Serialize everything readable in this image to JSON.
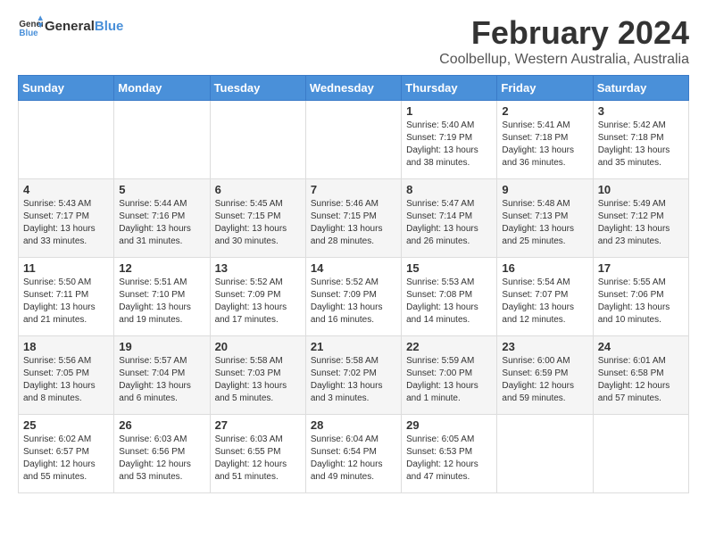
{
  "logo": {
    "text_general": "General",
    "text_blue": "Blue"
  },
  "title": "February 2024",
  "subtitle": "Coolbellup, Western Australia, Australia",
  "days_of_week": [
    "Sunday",
    "Monday",
    "Tuesday",
    "Wednesday",
    "Thursday",
    "Friday",
    "Saturday"
  ],
  "weeks": [
    [
      {
        "day": "",
        "info": ""
      },
      {
        "day": "",
        "info": ""
      },
      {
        "day": "",
        "info": ""
      },
      {
        "day": "",
        "info": ""
      },
      {
        "day": "1",
        "info": "Sunrise: 5:40 AM\nSunset: 7:19 PM\nDaylight: 13 hours\nand 38 minutes."
      },
      {
        "day": "2",
        "info": "Sunrise: 5:41 AM\nSunset: 7:18 PM\nDaylight: 13 hours\nand 36 minutes."
      },
      {
        "day": "3",
        "info": "Sunrise: 5:42 AM\nSunset: 7:18 PM\nDaylight: 13 hours\nand 35 minutes."
      }
    ],
    [
      {
        "day": "4",
        "info": "Sunrise: 5:43 AM\nSunset: 7:17 PM\nDaylight: 13 hours\nand 33 minutes."
      },
      {
        "day": "5",
        "info": "Sunrise: 5:44 AM\nSunset: 7:16 PM\nDaylight: 13 hours\nand 31 minutes."
      },
      {
        "day": "6",
        "info": "Sunrise: 5:45 AM\nSunset: 7:15 PM\nDaylight: 13 hours\nand 30 minutes."
      },
      {
        "day": "7",
        "info": "Sunrise: 5:46 AM\nSunset: 7:15 PM\nDaylight: 13 hours\nand 28 minutes."
      },
      {
        "day": "8",
        "info": "Sunrise: 5:47 AM\nSunset: 7:14 PM\nDaylight: 13 hours\nand 26 minutes."
      },
      {
        "day": "9",
        "info": "Sunrise: 5:48 AM\nSunset: 7:13 PM\nDaylight: 13 hours\nand 25 minutes."
      },
      {
        "day": "10",
        "info": "Sunrise: 5:49 AM\nSunset: 7:12 PM\nDaylight: 13 hours\nand 23 minutes."
      }
    ],
    [
      {
        "day": "11",
        "info": "Sunrise: 5:50 AM\nSunset: 7:11 PM\nDaylight: 13 hours\nand 21 minutes."
      },
      {
        "day": "12",
        "info": "Sunrise: 5:51 AM\nSunset: 7:10 PM\nDaylight: 13 hours\nand 19 minutes."
      },
      {
        "day": "13",
        "info": "Sunrise: 5:52 AM\nSunset: 7:09 PM\nDaylight: 13 hours\nand 17 minutes."
      },
      {
        "day": "14",
        "info": "Sunrise: 5:52 AM\nSunset: 7:09 PM\nDaylight: 13 hours\nand 16 minutes."
      },
      {
        "day": "15",
        "info": "Sunrise: 5:53 AM\nSunset: 7:08 PM\nDaylight: 13 hours\nand 14 minutes."
      },
      {
        "day": "16",
        "info": "Sunrise: 5:54 AM\nSunset: 7:07 PM\nDaylight: 13 hours\nand 12 minutes."
      },
      {
        "day": "17",
        "info": "Sunrise: 5:55 AM\nSunset: 7:06 PM\nDaylight: 13 hours\nand 10 minutes."
      }
    ],
    [
      {
        "day": "18",
        "info": "Sunrise: 5:56 AM\nSunset: 7:05 PM\nDaylight: 13 hours\nand 8 minutes."
      },
      {
        "day": "19",
        "info": "Sunrise: 5:57 AM\nSunset: 7:04 PM\nDaylight: 13 hours\nand 6 minutes."
      },
      {
        "day": "20",
        "info": "Sunrise: 5:58 AM\nSunset: 7:03 PM\nDaylight: 13 hours\nand 5 minutes."
      },
      {
        "day": "21",
        "info": "Sunrise: 5:58 AM\nSunset: 7:02 PM\nDaylight: 13 hours\nand 3 minutes."
      },
      {
        "day": "22",
        "info": "Sunrise: 5:59 AM\nSunset: 7:00 PM\nDaylight: 13 hours\nand 1 minute."
      },
      {
        "day": "23",
        "info": "Sunrise: 6:00 AM\nSunset: 6:59 PM\nDaylight: 12 hours\nand 59 minutes."
      },
      {
        "day": "24",
        "info": "Sunrise: 6:01 AM\nSunset: 6:58 PM\nDaylight: 12 hours\nand 57 minutes."
      }
    ],
    [
      {
        "day": "25",
        "info": "Sunrise: 6:02 AM\nSunset: 6:57 PM\nDaylight: 12 hours\nand 55 minutes."
      },
      {
        "day": "26",
        "info": "Sunrise: 6:03 AM\nSunset: 6:56 PM\nDaylight: 12 hours\nand 53 minutes."
      },
      {
        "day": "27",
        "info": "Sunrise: 6:03 AM\nSunset: 6:55 PM\nDaylight: 12 hours\nand 51 minutes."
      },
      {
        "day": "28",
        "info": "Sunrise: 6:04 AM\nSunset: 6:54 PM\nDaylight: 12 hours\nand 49 minutes."
      },
      {
        "day": "29",
        "info": "Sunrise: 6:05 AM\nSunset: 6:53 PM\nDaylight: 12 hours\nand 47 minutes."
      },
      {
        "day": "",
        "info": ""
      },
      {
        "day": "",
        "info": ""
      }
    ]
  ]
}
